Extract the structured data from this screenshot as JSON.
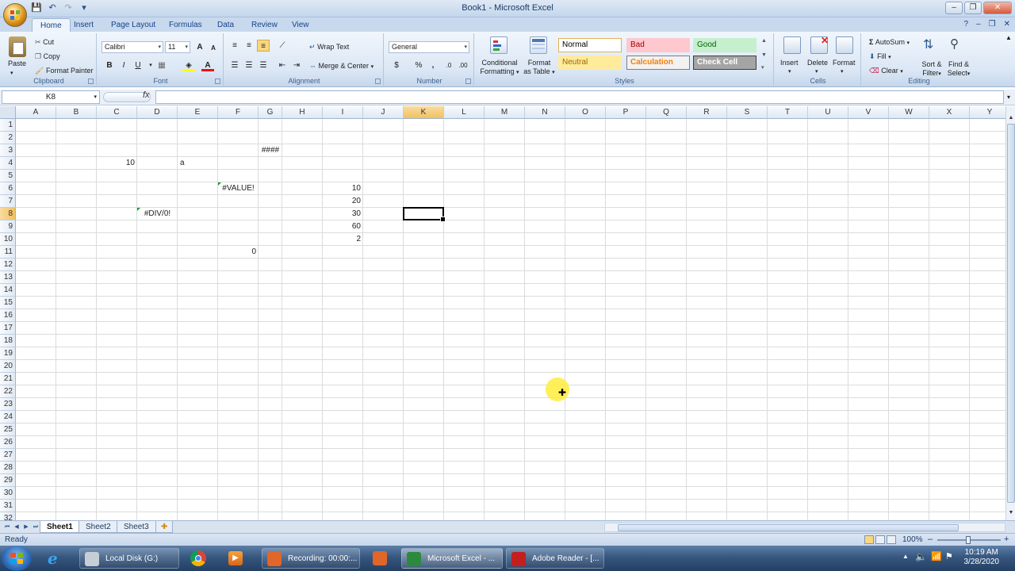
{
  "window": {
    "title": "Book1 - Microsoft Excel",
    "minimize": "–",
    "restore": "❐",
    "close": "✕"
  },
  "qat": {
    "save": "💾",
    "undo": "↶",
    "redo": "↷",
    "more": "▾"
  },
  "tabs": [
    "Home",
    "Insert",
    "Page Layout",
    "Formulas",
    "Data",
    "Review",
    "View"
  ],
  "active_tab": "Home",
  "ribbon": {
    "clipboard": {
      "label": "Clipboard",
      "paste": "Paste",
      "cut": "Cut",
      "copy": "Copy",
      "format_painter": "Format Painter"
    },
    "font": {
      "label": "Font",
      "name": "Calibri",
      "size": "11",
      "bold": "B",
      "italic": "I",
      "underline": "U",
      "grow": "A",
      "shrink": "A"
    },
    "alignment": {
      "label": "Alignment",
      "wrap_text": "Wrap Text",
      "merge_center": "Merge & Center"
    },
    "number": {
      "label": "Number",
      "format": "General",
      "currency": "$",
      "percent": "%",
      "comma": ","
    },
    "styles": {
      "label": "Styles",
      "conditional_formatting": [
        "Conditional",
        "Formatting"
      ],
      "format_as_table": [
        "Format",
        "as Table"
      ],
      "items": [
        {
          "name": "Normal",
          "bg": "#ffffff",
          "fg": "#000000",
          "border": "#e0b153"
        },
        {
          "name": "Bad",
          "bg": "#ffc7ce",
          "fg": "#9c0006"
        },
        {
          "name": "Good",
          "bg": "#c6efce",
          "fg": "#006100"
        },
        {
          "name": "Neutral",
          "bg": "#ffeb9c",
          "fg": "#9c6500"
        },
        {
          "name": "Calculation",
          "bg": "#f2f2f2",
          "fg": "#fa7d00",
          "border": "#7f7f7f"
        },
        {
          "name": "Check Cell",
          "bg": "#a5a5a5",
          "fg": "#ffffff",
          "border": "#3f3f3f"
        }
      ]
    },
    "cells": {
      "label": "Cells",
      "insert": "Insert",
      "delete": "Delete",
      "format": "Format"
    },
    "editing": {
      "label": "Editing",
      "autosum": "AutoSum",
      "fill": "Fill",
      "clear": "Clear",
      "sort_filter": [
        "Sort &",
        "Filter"
      ],
      "find_select": [
        "Find &",
        "Select"
      ]
    }
  },
  "formula_bar": {
    "name_box": "K8",
    "fx": "fx",
    "content": ""
  },
  "grid": {
    "columns": [
      "A",
      "B",
      "C",
      "D",
      "E",
      "F",
      "G",
      "H",
      "I",
      "J",
      "K",
      "L",
      "M",
      "N",
      "O",
      "P",
      "Q",
      "R",
      "S",
      "T",
      "U",
      "V",
      "W",
      "X",
      "Y"
    ],
    "rows": [
      "1",
      "2",
      "3",
      "4",
      "5",
      "6",
      "7",
      "8",
      "9",
      "10",
      "11",
      "12",
      "13",
      "14",
      "15",
      "16",
      "17",
      "18",
      "19",
      "20",
      "21",
      "22",
      "23",
      "24",
      "25",
      "26",
      "27",
      "28",
      "29",
      "30",
      "31",
      "32"
    ],
    "selected_col": "K",
    "selected_row": "8",
    "cells": [
      {
        "ref": "G3",
        "text": "####",
        "kind": "err"
      },
      {
        "ref": "C4",
        "text": "10",
        "kind": "num"
      },
      {
        "ref": "E4",
        "text": "a",
        "kind": "text"
      },
      {
        "ref": "F6",
        "text": "#VALUE!",
        "kind": "err",
        "flag": true
      },
      {
        "ref": "I6",
        "text": "10",
        "kind": "num"
      },
      {
        "ref": "I7",
        "text": "20",
        "kind": "num"
      },
      {
        "ref": "D8",
        "text": "#DIV/0!",
        "kind": "err",
        "flag": true
      },
      {
        "ref": "I8",
        "text": "30",
        "kind": "num"
      },
      {
        "ref": "I9",
        "text": "60",
        "kind": "num"
      },
      {
        "ref": "I10",
        "text": "2",
        "kind": "num"
      },
      {
        "ref": "F11",
        "text": "0",
        "kind": "num"
      }
    ]
  },
  "sheets": [
    "Sheet1",
    "Sheet2",
    "Sheet3"
  ],
  "active_sheet": "Sheet1",
  "status": {
    "text": "Ready",
    "zoom": "100%",
    "zoom_minus": "–",
    "zoom_plus": "+",
    "zoom_fraction": 0.5
  },
  "taskbar": {
    "items": [
      {
        "label": "Local Disk (G:)",
        "color": "#c7cdd6",
        "active": false
      },
      {
        "label": "Recording: 00:00:...",
        "color": "#e0662a",
        "active": false
      },
      {
        "label": "Microsoft Excel - ...",
        "color": "#2c8a3e",
        "active": true
      },
      {
        "label": "Adobe Reader - [...",
        "color": "#c41f1f",
        "active": false
      }
    ],
    "time": "10:19 AM",
    "date": "3/28/2020"
  }
}
